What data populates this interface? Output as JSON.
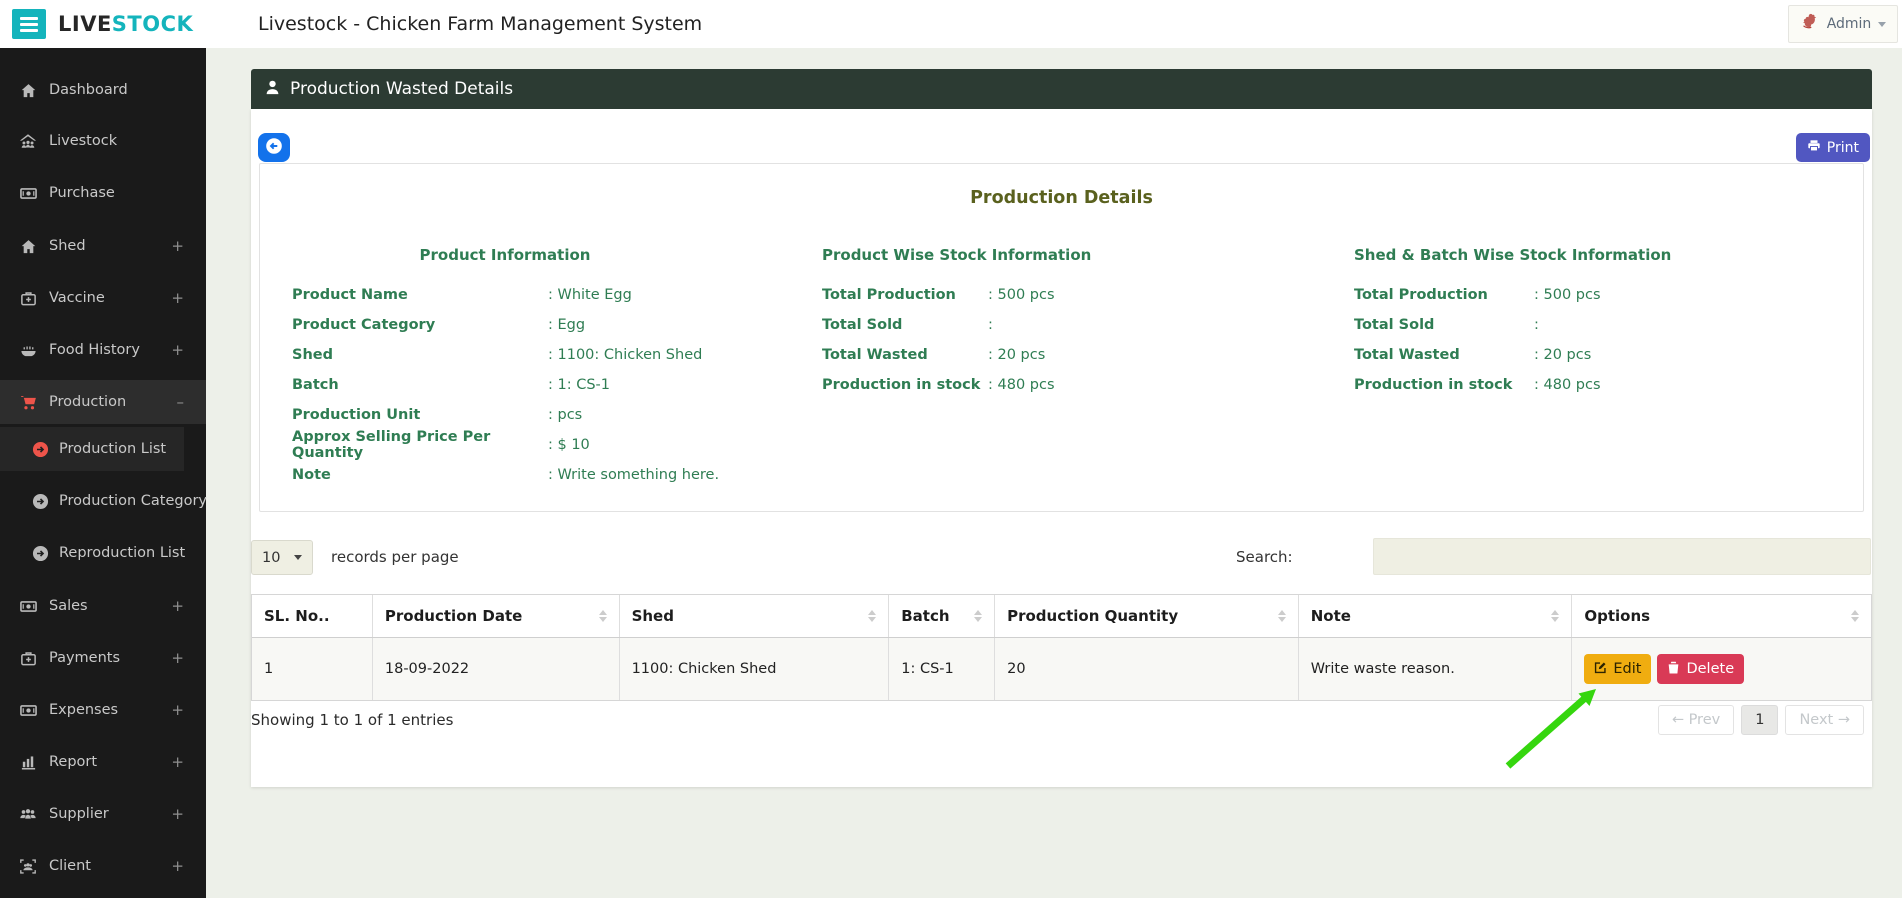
{
  "colors": {
    "teal_accent": "#14b4bc",
    "sidebar_active_red": "#ee544a",
    "detail_green": "#2f7d53",
    "detail_title_olive": "#5a611e",
    "panel_header_bg": "#2c3b33",
    "back_button_blue": "#1372eb",
    "print_button_indigo": "#5157c1",
    "edit_button_amber": "#f0ad10",
    "delete_button_red": "#d93a56",
    "annotation_arrow_green": "#35d60e"
  },
  "topbar": {
    "brand_live": "LIVE",
    "brand_stock": "STOCK",
    "title": "Livestock - Chicken Farm Management System",
    "user_label": "Admin"
  },
  "sidebar": {
    "items": [
      {
        "label": "Dashboard",
        "suffix": ""
      },
      {
        "label": "Livestock",
        "suffix": ""
      },
      {
        "label": "Purchase",
        "suffix": ""
      },
      {
        "label": "Shed",
        "suffix": "+"
      },
      {
        "label": "Vaccine",
        "suffix": "+"
      },
      {
        "label": "Food History",
        "suffix": "+"
      },
      {
        "label": "Production",
        "suffix": "–"
      },
      {
        "label": "Production List",
        "suffix": ""
      },
      {
        "label": "Production Category",
        "suffix": ""
      },
      {
        "label": "Reproduction List",
        "suffix": ""
      },
      {
        "label": "Sales",
        "suffix": "+"
      },
      {
        "label": "Payments",
        "suffix": "+"
      },
      {
        "label": "Expenses",
        "suffix": "+"
      },
      {
        "label": "Report",
        "suffix": "+"
      },
      {
        "label": "Supplier",
        "suffix": "+"
      },
      {
        "label": "Client",
        "suffix": "+"
      }
    ]
  },
  "panel": {
    "title": "Production Wasted Details",
    "print_label": "Print"
  },
  "details": {
    "title": "Production Details",
    "product_info": {
      "heading": "Product Information",
      "rows": [
        {
          "label": "Product Name",
          "value": ": White Egg"
        },
        {
          "label": "Product Category",
          "value": ": Egg"
        },
        {
          "label": "Shed",
          "value": ": 1100: Chicken Shed"
        },
        {
          "label": "Batch",
          "value": ": 1: CS-1"
        },
        {
          "label": "Production Unit",
          "value": ": pcs"
        },
        {
          "label": "Approx Selling Price Per Quantity",
          "value": ": $ 10"
        },
        {
          "label": "Note",
          "value": ": Write something here."
        }
      ]
    },
    "product_stock": {
      "heading": "Product Wise Stock Information",
      "rows": [
        {
          "label": "Total Production",
          "value": ": 500 pcs"
        },
        {
          "label": "Total Sold",
          "value": ":"
        },
        {
          "label": "Total Wasted",
          "value": ": 20 pcs"
        },
        {
          "label": "Production in stock",
          "value": ": 480 pcs"
        }
      ]
    },
    "shed_stock": {
      "heading": "Shed & Batch Wise Stock Information",
      "rows": [
        {
          "label": "Total Production",
          "value": ": 500 pcs"
        },
        {
          "label": "Total Sold",
          "value": ":"
        },
        {
          "label": "Total Wasted",
          "value": ": 20 pcs"
        },
        {
          "label": "Production in stock",
          "value": ": 480 pcs"
        }
      ]
    }
  },
  "controls": {
    "page_size": "10",
    "records_label": "records per page",
    "search_label": "Search:",
    "search_value": ""
  },
  "table": {
    "headers": [
      "SL. No..",
      "Production Date",
      "Shed",
      "Batch",
      "Production Quantity",
      "Note",
      "Options"
    ],
    "rows": [
      [
        "1",
        "18-09-2022",
        "1100: Chicken Shed",
        "1: CS-1",
        "20",
        "Write waste reason."
      ]
    ],
    "actions": {
      "edit": "Edit",
      "delete": "Delete"
    }
  },
  "footer": {
    "showing": "Showing 1 to 1 of 1 entries",
    "prev": "← Prev",
    "page": "1",
    "next": "Next →"
  }
}
